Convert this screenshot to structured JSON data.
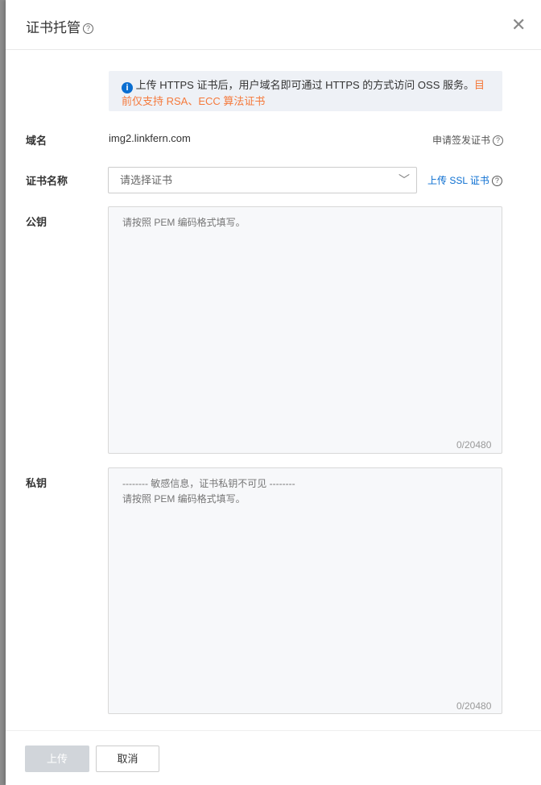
{
  "dialog": {
    "title": "证书托管",
    "close_icon": "close-icon"
  },
  "notice": {
    "text": "上传 HTTPS 证书后，用户域名即可通过 HTTPS 的方式访问 OSS 服务。",
    "warning": "目前仅支持 RSA、ECC 算法证书"
  },
  "form": {
    "domain_label": "域名",
    "domain_value": "img2.linkfern.com",
    "apply_link": "申请签发证书",
    "cert_label": "证书名称",
    "cert_placeholder": "请选择证书",
    "upload_ssl_link": "上传 SSL 证书",
    "public_key_label": "公钥",
    "public_key_placeholder": "请按照 PEM 编码格式填写。",
    "public_key_count": "0/20480",
    "private_key_label": "私钥",
    "private_key_placeholder": "-------- 敏感信息，证书私钥不可见 --------\n请按照 PEM 编码格式填写。",
    "private_key_count": "0/20480"
  },
  "footer": {
    "upload": "上传",
    "cancel": "取消"
  }
}
